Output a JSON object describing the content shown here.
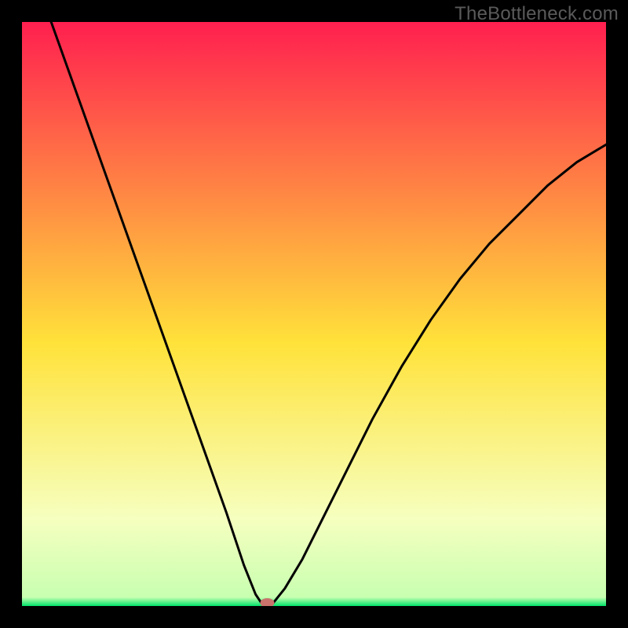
{
  "watermark": "TheBottleneck.com",
  "colors": {
    "frame": "#000000",
    "watermark_text": "#5a5a5a",
    "curve": "#000000",
    "marker_fill": "#c9736c",
    "gradient_top": "#ff1f4f",
    "gradient_yellow": "#ffe23a",
    "gradient_pale": "#f6ffbf",
    "gradient_green": "#00e36a"
  },
  "chart_data": {
    "type": "line",
    "title": "",
    "xlabel": "",
    "ylabel": "",
    "xlim": [
      0,
      100
    ],
    "ylim": [
      0,
      100
    ],
    "series": [
      {
        "name": "bottleneck-curve",
        "x": [
          0,
          5,
          10,
          15,
          20,
          25,
          30,
          35,
          38,
          40,
          41,
          42,
          43,
          45,
          48,
          52,
          56,
          60,
          65,
          70,
          75,
          80,
          85,
          90,
          95,
          100
        ],
        "y": [
          115,
          100,
          86,
          72,
          58,
          44,
          30,
          16,
          7,
          2,
          0.5,
          0,
          0.5,
          3,
          8,
          16,
          24,
          32,
          41,
          49,
          56,
          62,
          67,
          72,
          76,
          79
        ]
      }
    ],
    "marker": {
      "x": 42,
      "y": 0
    }
  }
}
